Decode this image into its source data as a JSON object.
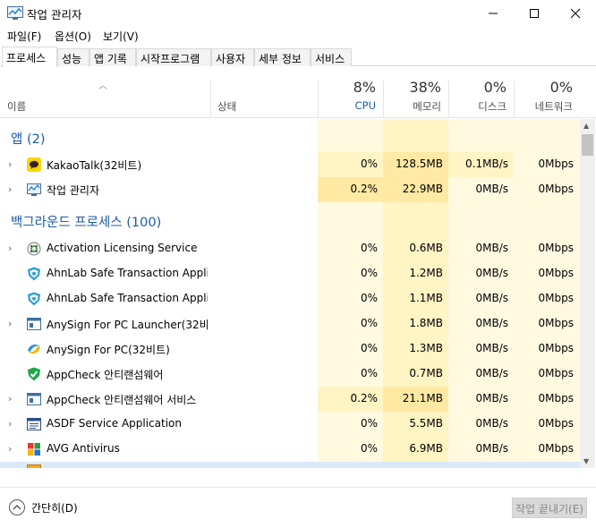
{
  "window": {
    "title": "작업 관리자"
  },
  "menu": [
    "파일(F)",
    "옵션(O)",
    "보기(V)"
  ],
  "tabs": [
    "프로세스",
    "성능",
    "앱 기록",
    "시작프로그램",
    "사용자",
    "세부 정보",
    "서비스"
  ],
  "header": {
    "name_label": "이름",
    "status_label": "상태",
    "cpu": {
      "percent": "8%",
      "label": "CPU"
    },
    "memory": {
      "percent": "38%",
      "label": "메모리"
    },
    "disk": {
      "percent": "0%",
      "label": "디스크"
    },
    "network": {
      "percent": "0%",
      "label": "네트워크"
    }
  },
  "groups": {
    "apps": "앱 (2)",
    "background": "백그라운드 프로세스 (100)"
  },
  "rows": [
    {
      "name": "KakaoTalk(32비트)",
      "cpu": "0%",
      "mem": "128.5MB",
      "disk": "0.1MB/s",
      "net": "0Mbps",
      "icon": "kakaotalk-icon"
    },
    {
      "name": "작업 관리자",
      "cpu": "0.2%",
      "mem": "22.9MB",
      "disk": "0MB/s",
      "net": "0Mbps",
      "icon": "task-manager-icon"
    },
    {
      "name": "Activation Licensing Service",
      "cpu": "0%",
      "mem": "0.6MB",
      "disk": "0MB/s",
      "net": "0Mbps",
      "icon": "service-gear-icon"
    },
    {
      "name": "AhnLab Safe Transaction Appli...",
      "cpu": "0%",
      "mem": "1.2MB",
      "disk": "0MB/s",
      "net": "0Mbps",
      "icon": "ahnlab-shield-icon"
    },
    {
      "name": "AhnLab Safe Transaction Appli...",
      "cpu": "0%",
      "mem": "1.1MB",
      "disk": "0MB/s",
      "net": "0Mbps",
      "icon": "ahnlab-shield-icon"
    },
    {
      "name": "AnySign For PC Launcher(32비...",
      "cpu": "0%",
      "mem": "1.8MB",
      "disk": "0MB/s",
      "net": "0Mbps",
      "icon": "app-window-icon"
    },
    {
      "name": "AnySign For PC(32비트)",
      "cpu": "0%",
      "mem": "1.3MB",
      "disk": "0MB/s",
      "net": "0Mbps",
      "icon": "anysign-icon"
    },
    {
      "name": "AppCheck 안티랜섬웨어",
      "cpu": "0%",
      "mem": "0.7MB",
      "disk": "0MB/s",
      "net": "0Mbps",
      "icon": "appcheck-icon"
    },
    {
      "name": "AppCheck 안티랜섬웨어 서비스",
      "cpu": "0.2%",
      "mem": "21.1MB",
      "disk": "0MB/s",
      "net": "0Mbps",
      "icon": "app-window-icon"
    },
    {
      "name": "ASDF Service Application",
      "cpu": "0%",
      "mem": "5.5MB",
      "disk": "0MB/s",
      "net": "0Mbps",
      "icon": "asdf-icon"
    },
    {
      "name": "AVG Antivirus",
      "cpu": "0%",
      "mem": "6.9MB",
      "disk": "0MB/s",
      "net": "0Mbps",
      "icon": "avg-icon"
    }
  ],
  "footer": {
    "collapse_label": "간단히(D)",
    "end_task_label": "작업 끝내기(E)"
  },
  "colors": {
    "group_title": "#1e5aa8",
    "cell_light": "#fff4c4",
    "cell_medium": "#ffe9a3",
    "selected_row": "#dbe8f7"
  }
}
